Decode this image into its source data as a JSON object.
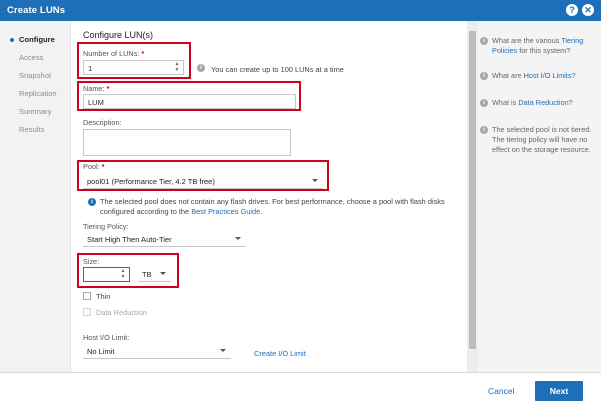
{
  "window": {
    "title": "Create LUNs"
  },
  "nav": {
    "items": [
      {
        "label": "Configure"
      },
      {
        "label": "Access"
      },
      {
        "label": "Snapshot"
      },
      {
        "label": "Replication"
      },
      {
        "label": "Summary"
      },
      {
        "label": "Results"
      }
    ]
  },
  "form": {
    "heading": "Configure LUN(s)",
    "num_luns": {
      "label": "Number of LUNs:",
      "required": "*",
      "value": "1",
      "hint": "You can create up to 100 LUNs at a time"
    },
    "name": {
      "label": "Name:",
      "required": "*",
      "value": "LUM"
    },
    "description": {
      "label": "Description:",
      "value": ""
    },
    "pool": {
      "label": "Pool:",
      "required": "*",
      "value": "pool01 (Performance Tier, 4.2 TB free)"
    },
    "pool_notice": {
      "text_before": "The selected pool does not contain any flash drives. For best performance, choose a pool with flash disks configured according to the",
      "link": "Best Practices Guide",
      "text_after": "."
    },
    "tiering": {
      "label": "Tiering Policy:",
      "value": "Start High Then Auto-Tier"
    },
    "size": {
      "label": "Size:",
      "value": "",
      "unit": "TB"
    },
    "thin": {
      "label": "Thin"
    },
    "data_reduction": {
      "label": "Data Reduction"
    },
    "host_io": {
      "label": "Host I/O Limit:",
      "value": "No Limit",
      "create_link": "Create I/O Limit"
    }
  },
  "help": {
    "tiering": {
      "prefix": "What are the various",
      "link": "Tiering Policies",
      "suffix": "for this system?"
    },
    "host_io": {
      "prefix": "What are",
      "link": "Host I/O Limits",
      "suffix": "?"
    },
    "data_reduction": {
      "prefix": "What is",
      "link": "Data Reduction",
      "suffix": "?"
    },
    "pool_note": "The selected pool is not tiered. The tiering policy will have no effect on the storage resource."
  },
  "footer": {
    "cancel": "Cancel",
    "next": "Next"
  },
  "colors": {
    "accent": "#1d6fb8",
    "highlight": "#d0021b"
  }
}
